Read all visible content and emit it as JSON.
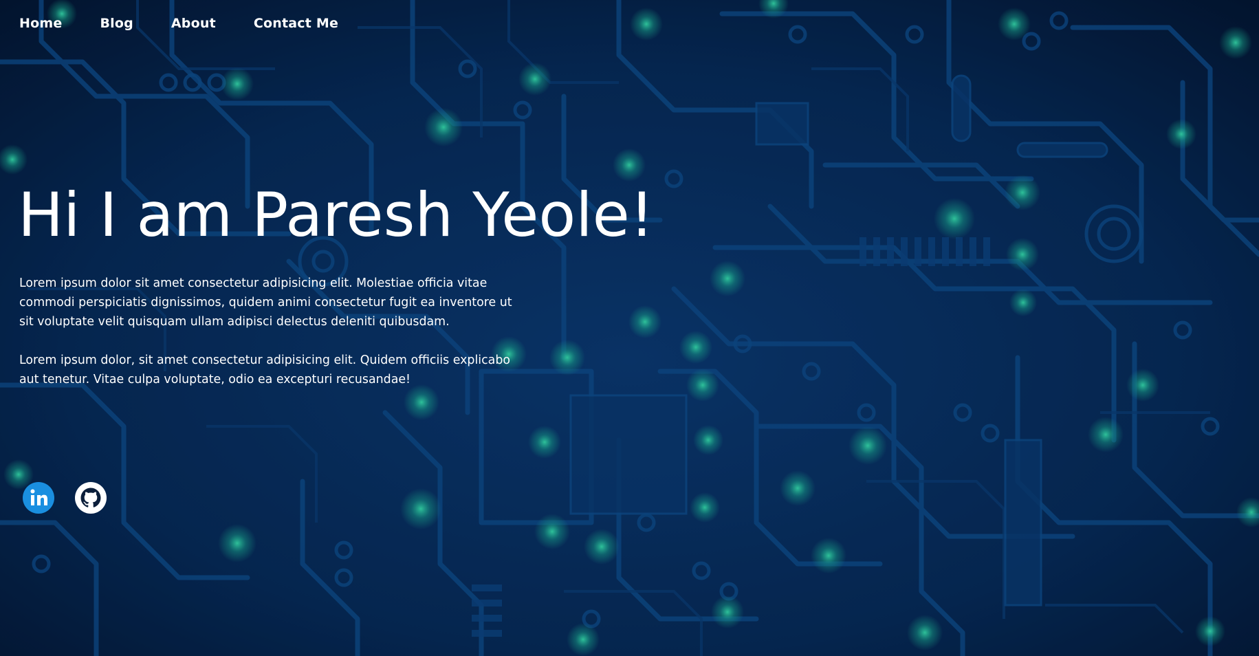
{
  "nav": {
    "items": [
      {
        "label": "Home"
      },
      {
        "label": "Blog"
      },
      {
        "label": "About"
      },
      {
        "label": "Contact Me"
      }
    ]
  },
  "hero": {
    "title": "Hi I am Paresh Yeole!",
    "paragraphs": [
      "Lorem ipsum dolor sit amet consectetur adipisicing elit. Molestiae officia vitae commodi perspiciatis dignissimos, quidem animi consectetur fugit ea inventore ut sit voluptate velit quisquam ullam adipisci delectus deleniti quibusdam.",
      "Lorem ipsum dolor, sit amet consectetur adipisicing elit. Quidem officiis explicabo aut tenetur. Vitae culpa voluptate, odio ea excepturi recusandae!"
    ]
  },
  "social": {
    "icons": [
      "linkedin-icon",
      "github-icon"
    ]
  },
  "colors": {
    "background": "#06193a",
    "circuit": "#0d4a86",
    "glow": "#1fd3a0",
    "text": "#ffffff",
    "linkedin": "#1a8fe0"
  }
}
